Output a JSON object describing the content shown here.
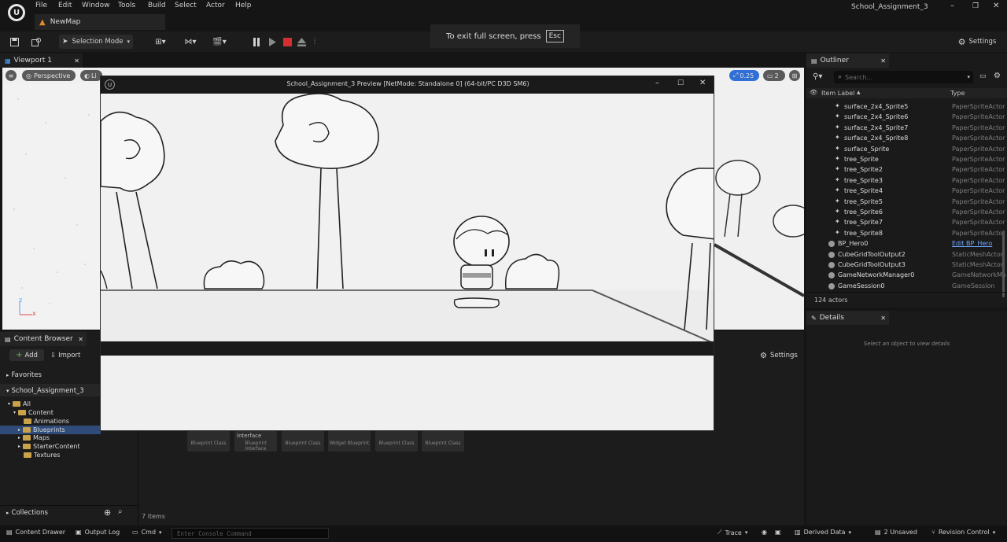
{
  "app": {
    "logo_icon": "unreal-logo-icon",
    "project_name": "School_Assignment_3",
    "map_tab": "NewMap",
    "menu": [
      "File",
      "Edit",
      "Window",
      "Tools",
      "Build",
      "Select",
      "Actor",
      "Help"
    ]
  },
  "toolbar": {
    "selection_mode": "Selection Mode",
    "settings": "Settings"
  },
  "fullscreen_banner": {
    "text": "To exit full screen, press",
    "key": "Esc"
  },
  "viewport": {
    "tab_label": "Viewport 1",
    "perspective": "Perspective",
    "lit": "Li",
    "snap_value": "0.25",
    "camera_speed": "2",
    "axis_z": "z",
    "axis_x": "x"
  },
  "preview_window": {
    "title": "School_Assignment_3 Preview [NetMode: Standalone 0]  (64-bit/PC D3D SM6)"
  },
  "outliner": {
    "tab_label": "Outliner",
    "search_placeholder": "Search...",
    "col_label": "Item Label",
    "col_type": "Type",
    "rows": [
      {
        "label": "surface_2x4_Sprite5",
        "type": "PaperSpriteActor"
      },
      {
        "label": "surface_2x4_Sprite6",
        "type": "PaperSpriteActor"
      },
      {
        "label": "surface_2x4_Sprite7",
        "type": "PaperSpriteActor"
      },
      {
        "label": "surface_2x4_Sprite8",
        "type": "PaperSpriteActor"
      },
      {
        "label": "surface_Sprite",
        "type": "PaperSpriteActor"
      },
      {
        "label": "tree_Sprite",
        "type": "PaperSpriteActor"
      },
      {
        "label": "tree_Sprite2",
        "type": "PaperSpriteActor"
      },
      {
        "label": "tree_Sprite3",
        "type": "PaperSpriteActor"
      },
      {
        "label": "tree_Sprite4",
        "type": "PaperSpriteActor"
      },
      {
        "label": "tree_Sprite5",
        "type": "PaperSpriteActor"
      },
      {
        "label": "tree_Sprite6",
        "type": "PaperSpriteActor"
      },
      {
        "label": "tree_Sprite7",
        "type": "PaperSpriteActor"
      },
      {
        "label": "tree_Sprite8",
        "type": "PaperSpriteActor"
      },
      {
        "label": "BP_Hero0",
        "type": "Edit BP_Hero"
      },
      {
        "label": "CubeGridToolOutput2",
        "type": "StaticMeshActor"
      },
      {
        "label": "CubeGridToolOutput3",
        "type": "StaticMeshActor"
      },
      {
        "label": "GameNetworkManager0",
        "type": "GameNetworkManager"
      },
      {
        "label": "GameSession0",
        "type": "GameSession"
      }
    ],
    "actor_count": "124 actors"
  },
  "details": {
    "tab_label": "Details",
    "empty_text": "Select an object to view details"
  },
  "content_browser": {
    "tab_label": "Content Browser",
    "add": "Add",
    "import": "Import",
    "settings": "Settings",
    "favorites": "Favorites",
    "project_root": "School_Assignment_3",
    "tree": [
      "All",
      "Content",
      "Animations",
      "Blueprints",
      "Maps",
      "StarterContent",
      "Textures"
    ],
    "assets": [
      {
        "name": "",
        "kind": "Blueprint Class"
      },
      {
        "name": "Interface",
        "kind": "Blueprint Interface"
      },
      {
        "name": "",
        "kind": "Blueprint Class"
      },
      {
        "name": "",
        "kind": "Widget Blueprint"
      },
      {
        "name": "",
        "kind": "Blueprint Class"
      },
      {
        "name": "",
        "kind": "Blueprint Class"
      }
    ],
    "item_count": "7 items",
    "collections": "Collections"
  },
  "statusbar": {
    "content_drawer": "Content Drawer",
    "output_log": "Output Log",
    "cmd": "Cmd",
    "console_placeholder": "Enter Console Command",
    "trace": "Trace",
    "derived_data": "Derived Data",
    "unsaved": "2 Unsaved",
    "revision_control": "Revision Control"
  },
  "colors": {
    "editor_bg": "#151515",
    "panel_bg": "#1c1c1c",
    "accent_blue": "#2f6fd6",
    "stop_red": "#d32f2f",
    "folder_gold": "#c9a24a",
    "selected_row": "#2f4b7a"
  }
}
